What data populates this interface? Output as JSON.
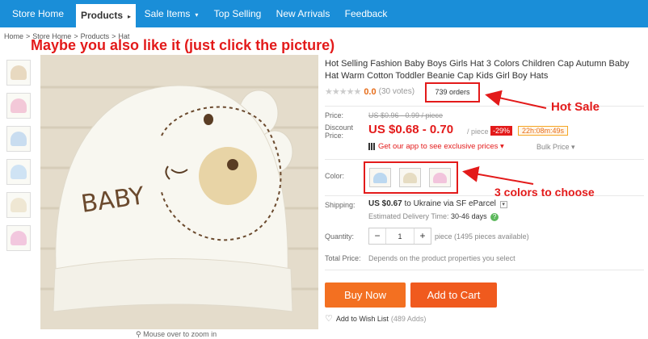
{
  "nav": {
    "items": [
      "Store Home",
      "Products",
      "Sale Items",
      "Top Selling",
      "New Arrivals",
      "Feedback"
    ],
    "active": "Products",
    "colors": {
      "bar": "#1a8ed8"
    }
  },
  "breadcrumb": [
    "Home",
    ">",
    "Store Home",
    ">",
    "Products",
    ">",
    "Hat"
  ],
  "banner": "Maybe you also like it (just click the picture)",
  "image": {
    "print_text": "BABY",
    "zoom_hint": "Mouse over to zoom in",
    "thumb_colors": [
      "#e8d9c0",
      "#f3c8d8",
      "#c9ddf0",
      "#cfe3f4",
      "#efe7d3",
      "#f2c7de"
    ]
  },
  "product": {
    "title": "Hot Selling Fashion Baby Boys Girls Hat 3 Colors Children Cap Autumn Baby Hat Warm Cotton Toddler Beanie Cap Kids Girl Boy Hats",
    "stars": "★★★★★",
    "rating": "0.0",
    "votes": "(30 votes)",
    "orders": "739 orders",
    "price_label": "Price:",
    "old_price": "US $0.96 - 0.99 / piece",
    "discount_label_1": "Discount",
    "discount_label_2": "Price:",
    "new_price": "US $0.68 - 0.70",
    "per_piece": "/ piece",
    "discount_badge": "-29%",
    "timer": "22h:08m:49s",
    "app_promo": "Get our app to see exclusive prices ▾",
    "bulk_price": "Bulk Price ▾",
    "color_label": "Color:",
    "swatches": [
      {
        "name": "blue",
        "color": "#bcd8f0"
      },
      {
        "name": "beige",
        "color": "#e6dcc2"
      },
      {
        "name": "pink",
        "color": "#f2c4dc"
      }
    ],
    "shipping_label": "Shipping:",
    "shipping_value": "US $0.67",
    "shipping_rest": "to Ukraine via SF eParcel",
    "delivery_prefix": "Estimated Delivery Time:",
    "delivery_days": "30-46 days",
    "quantity_label": "Quantity:",
    "qty_minus": "−",
    "qty_value": "1",
    "qty_plus": "+",
    "qty_note": "piece (1495 pieces available)",
    "total_label": "Total Price:",
    "total_note": "Depends on the product properties you select",
    "buy_now": "Buy Now",
    "add_to_cart": "Add to Cart",
    "wish": "Add to Wish List",
    "wish_count": "(489 Adds)"
  },
  "annotations": {
    "hot_sale": "Hot Sale",
    "colors": "3 colors to choose"
  }
}
